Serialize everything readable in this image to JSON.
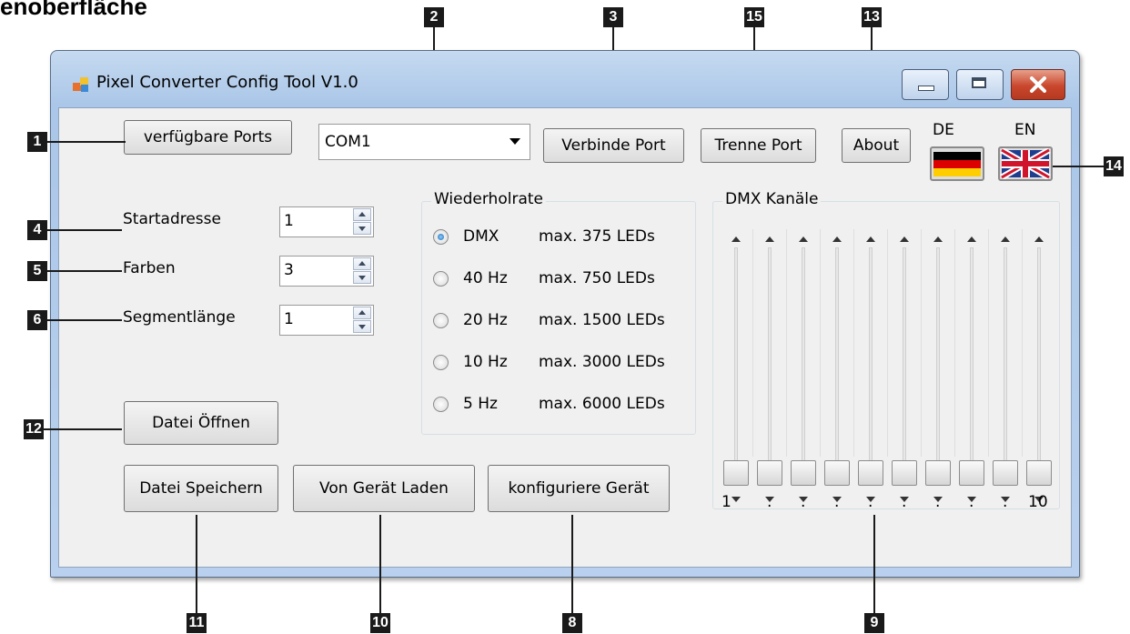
{
  "heading": "enoberfläche",
  "window": {
    "title": "Pixel Converter Config Tool V1.0",
    "icon": "app-icon"
  },
  "toolbar": {
    "ports_button": "verfügbare Ports",
    "port_value": "COM1",
    "connect_button": "Verbinde Port",
    "disconnect_button": "Trenne Port",
    "about_button": "About",
    "lang_de": "DE",
    "lang_en": "EN"
  },
  "settings": {
    "start_label": "Startadresse",
    "start_value": "1",
    "colors_label": "Farben",
    "colors_value": "3",
    "segment_label": "Segmentlänge",
    "segment_value": "1"
  },
  "repeat": {
    "title": "Wiederholrate",
    "options": [
      {
        "rate": "DMX",
        "leds": "max. 375 LEDs",
        "checked": true
      },
      {
        "rate": "40 Hz",
        "leds": "max. 750 LEDs",
        "checked": false
      },
      {
        "rate": "20 Hz",
        "leds": "max. 1500 LEDs",
        "checked": false
      },
      {
        "rate": "10 Hz",
        "leds": "max. 3000 LEDs",
        "checked": false
      },
      {
        "rate": "5 Hz",
        "leds": "max. 6000 LEDs",
        "checked": false
      }
    ]
  },
  "dmx": {
    "title": "DMX Kanäle",
    "channel_count": 10,
    "first_label": "1",
    "last_label": "10",
    "dot": "."
  },
  "actions": {
    "open_button": "Datei Öffnen",
    "save_button": "Datei Speichern",
    "load_button": "Von Gerät Laden",
    "configure_button": "konfiguriere Gerät"
  },
  "callouts": {
    "c1": "1",
    "c2": "2",
    "c3": "3",
    "c4": "4",
    "c5": "5",
    "c6": "6",
    "c8": "8",
    "c9": "9",
    "c10": "10",
    "c11": "11",
    "c12": "12",
    "c13": "13",
    "c14": "14",
    "c15": "15"
  },
  "colors": {
    "accent": "#1b67b5",
    "title_bar": "#aac6e8",
    "close_button": "#c9472d",
    "callout": "#1a1a1a"
  }
}
